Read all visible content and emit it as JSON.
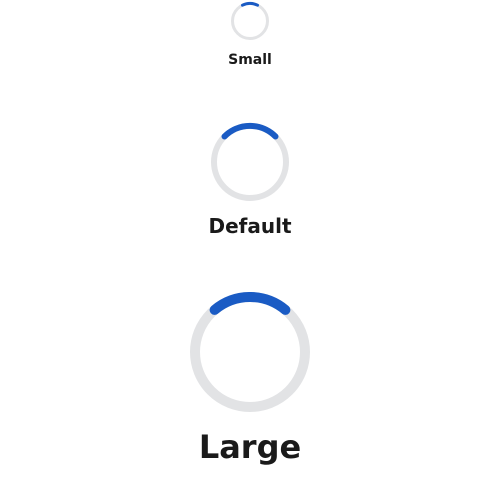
{
  "colors": {
    "track": "#e2e3e5",
    "indicator": "#1a5bc4",
    "label_text": "#1a1a1a",
    "background": "#ffffff"
  },
  "spinners": {
    "small": {
      "label": "Small",
      "icon": "loading-spinner-icon"
    },
    "default": {
      "label": "Default",
      "icon": "loading-spinner-icon"
    },
    "large": {
      "label": "Large",
      "icon": "loading-spinner-icon"
    }
  }
}
